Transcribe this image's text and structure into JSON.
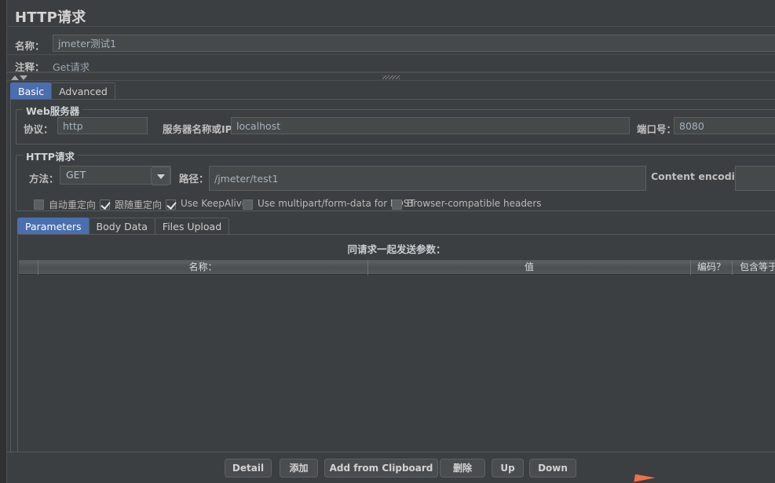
{
  "window": {
    "title": "HTTP请求"
  },
  "header": {
    "name_label": "名称：",
    "name_value": "jmeter测试1",
    "comment_label": "注释：",
    "comment_value": "Get请求"
  },
  "main_tabs": [
    {
      "label": "Basic",
      "selected": true
    },
    {
      "label": "Advanced",
      "selected": false
    }
  ],
  "web_server": {
    "group_title": "Web服务器",
    "protocol_label": "协议：",
    "protocol_value": "http",
    "server_label": "服务器名称或IP：",
    "server_value": "localhost",
    "port_label": "端口号：",
    "port_value": "8080"
  },
  "http_request": {
    "group_title": "HTTP请求",
    "method_label": "方法：",
    "method_value": "GET",
    "path_label": "路径：",
    "path_value": "/jmeter/test1",
    "content_encoding_label": "Content encoding:",
    "content_encoding_value": "",
    "checkboxes": [
      {
        "label": "自动重定向",
        "checked": false
      },
      {
        "label": "跟随重定向",
        "checked": true
      },
      {
        "label": "Use KeepAlive",
        "checked": true
      },
      {
        "label": "Use multipart/form-data for POST",
        "checked": false
      },
      {
        "label": "Browser-compatible headers",
        "checked": false
      }
    ]
  },
  "sub_tabs": [
    {
      "label": "Parameters",
      "selected": true
    },
    {
      "label": "Body Data",
      "selected": false
    },
    {
      "label": "Files Upload",
      "selected": false
    }
  ],
  "parameters": {
    "caption": "同请求一起发送参数：",
    "columns": [
      "名称：",
      "值",
      "编码？",
      "包含等于？"
    ],
    "rows": []
  },
  "buttons": [
    {
      "label": "Detail"
    },
    {
      "label": "添加"
    },
    {
      "label": "Add from Clipboard"
    },
    {
      "label": "删除"
    },
    {
      "label": "Up"
    },
    {
      "label": "Down"
    }
  ],
  "colors": {
    "background": "#3c3f41",
    "accent": "#4b6eaf",
    "field_background": "#45494a",
    "field_text": "#a5b1bd",
    "border": "#565a5c",
    "cursor": "#ef7144"
  }
}
